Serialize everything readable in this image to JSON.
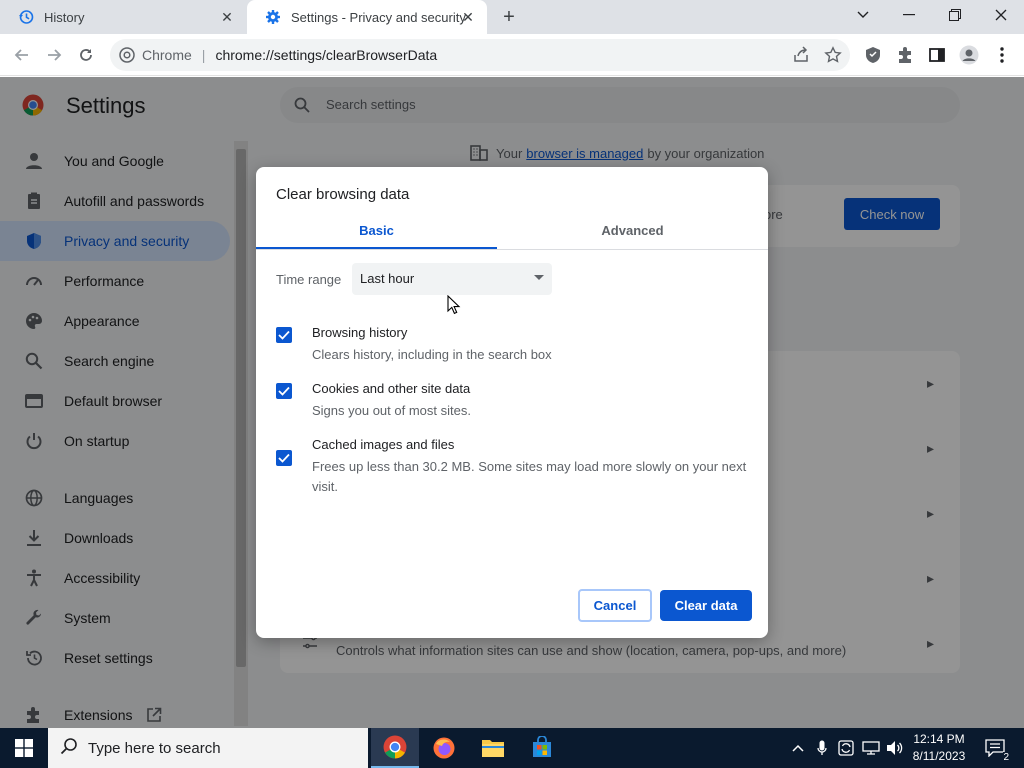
{
  "browser": {
    "tabs": [
      {
        "title": "History",
        "icon": "history-icon"
      },
      {
        "title": "Settings - Privacy and security",
        "icon": "gear-icon"
      }
    ],
    "omnibox_chip": "Chrome",
    "url": "chrome://settings/clearBrowserData"
  },
  "settings": {
    "title": "Settings",
    "search_placeholder": "Search settings",
    "sidebar": [
      {
        "label": "You and Google",
        "icon": "person-icon"
      },
      {
        "label": "Autofill and passwords",
        "icon": "clipboard-icon"
      },
      {
        "label": "Privacy and security",
        "icon": "shield-icon",
        "selected": true
      },
      {
        "label": "Performance",
        "icon": "speedometer-icon"
      },
      {
        "label": "Appearance",
        "icon": "palette-icon"
      },
      {
        "label": "Search engine",
        "icon": "search-icon"
      },
      {
        "label": "Default browser",
        "icon": "browser-window-icon"
      },
      {
        "label": "On startup",
        "icon": "power-icon"
      },
      {
        "label": "Languages",
        "icon": "globe-icon"
      },
      {
        "label": "Downloads",
        "icon": "download-icon"
      },
      {
        "label": "Accessibility",
        "icon": "accessibility-icon"
      },
      {
        "label": "System",
        "icon": "wrench-icon"
      },
      {
        "label": "Reset settings",
        "icon": "reset-icon"
      },
      {
        "label": "Extensions",
        "icon": "puzzle-icon"
      }
    ],
    "managed": {
      "prefix": "Your",
      "link": "browser is managed",
      "suffix": "by your organization"
    },
    "safety_check_partial": "ore",
    "check_now": "Check now",
    "site_settings_desc": "Controls what information sites can use and show (location, camera, pop-ups, and more)"
  },
  "dialog": {
    "title": "Clear browsing data",
    "tabs": {
      "basic": "Basic",
      "advanced": "Advanced"
    },
    "time_range_label": "Time range",
    "time_range_value": "Last hour",
    "options": [
      {
        "title": "Browsing history",
        "subtitle": "Clears history, including in the search box",
        "checked": true
      },
      {
        "title": "Cookies and other site data",
        "subtitle": "Signs you out of most sites.",
        "checked": true
      },
      {
        "title": "Cached images and files",
        "subtitle": "Frees up less than 30.2 MB. Some sites may load more slowly on your next visit.",
        "checked": true
      }
    ],
    "cancel": "Cancel",
    "clear": "Clear data"
  },
  "taskbar": {
    "search_placeholder": "Type here to search",
    "time": "12:14 PM",
    "date": "8/11/2023",
    "notification_count": "2"
  },
  "colors": {
    "accent": "#0b57d0",
    "taskbar": "#0a1a2e"
  }
}
